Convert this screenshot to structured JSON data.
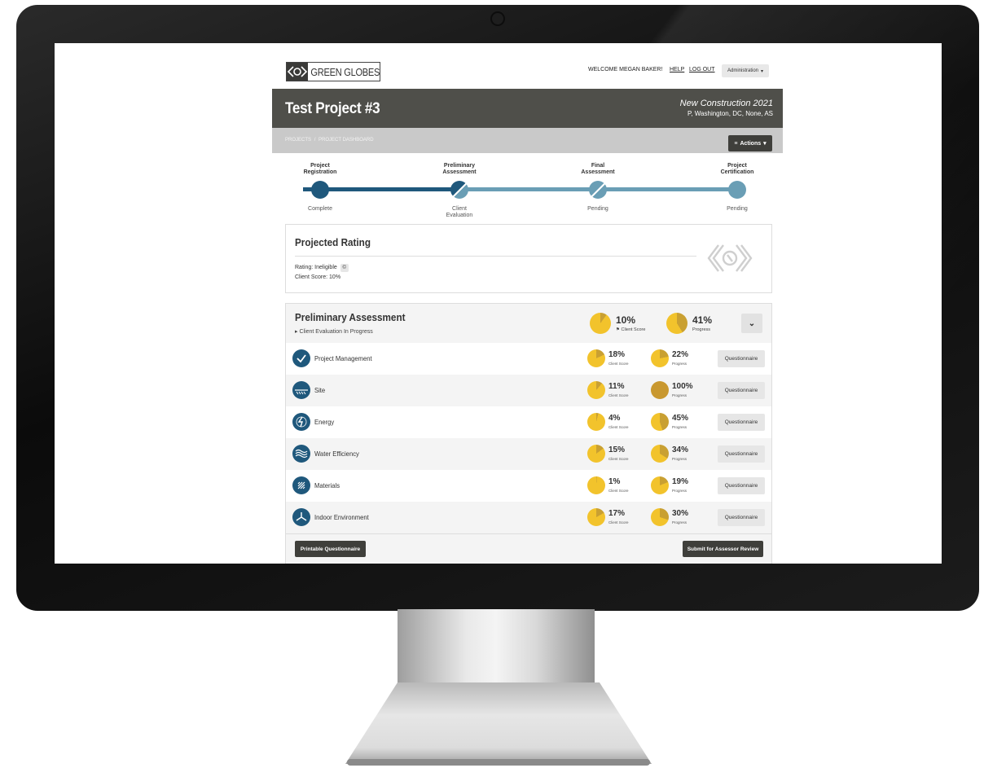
{
  "brand": {
    "name": "GREEN GLOBES"
  },
  "topnav": {
    "welcome": "WELCOME MEGAN BAKER!",
    "help": "HELP",
    "logout": "LOG OUT",
    "admin": "Administration"
  },
  "project": {
    "title": "Test Project #3",
    "type": "New Construction 2021",
    "location": "P, Washington, DC, None, AS"
  },
  "breadcrumb": {
    "projects": "PROJECTS",
    "separator": "/",
    "current": "PROJECT DASHBOARD"
  },
  "actions_label": "Actions",
  "steps": [
    {
      "title_1": "Project",
      "title_2": "Registration",
      "status_1": "Complete",
      "status_2": ""
    },
    {
      "title_1": "Preliminary",
      "title_2": "Assessment",
      "status_1": "Client",
      "status_2": "Evaluation"
    },
    {
      "title_1": "Final",
      "title_2": "Assessment",
      "status_1": "Pending",
      "status_2": ""
    },
    {
      "title_1": "Project",
      "title_2": "Certification",
      "status_1": "Pending",
      "status_2": ""
    }
  ],
  "projected_rating": {
    "title": "Projected Rating",
    "rating_label": "Rating:",
    "rating_value": "Ineligible",
    "client_score_label": "Client Score:",
    "client_score_value": "10%"
  },
  "assessment": {
    "title": "Preliminary Assessment",
    "status": "Client Evaluation In Progress",
    "client_score": {
      "pct": "10%",
      "label": "Client Score",
      "value": 0.1
    },
    "progress": {
      "pct": "41%",
      "label": "Progress",
      "value": 0.41
    },
    "categories": [
      {
        "name": "Project Management",
        "icon": "check-icon",
        "score": "18%",
        "score_value": 0.18,
        "progress": "22%",
        "progress_value": 0.22
      },
      {
        "name": "Site",
        "icon": "site-icon",
        "score": "11%",
        "score_value": 0.11,
        "progress": "100%",
        "progress_value": 1.0
      },
      {
        "name": "Energy",
        "icon": "energy-icon",
        "score": "4%",
        "score_value": 0.04,
        "progress": "45%",
        "progress_value": 0.45
      },
      {
        "name": "Water Efficiency",
        "icon": "water-icon",
        "score": "15%",
        "score_value": 0.15,
        "progress": "34%",
        "progress_value": 0.34
      },
      {
        "name": "Materials",
        "icon": "materials-icon",
        "score": "1%",
        "score_value": 0.01,
        "progress": "19%",
        "progress_value": 0.19
      },
      {
        "name": "Indoor Environment",
        "icon": "indoor-environment-icon",
        "score": "17%",
        "score_value": 0.17,
        "progress": "30%",
        "progress_value": 0.3
      }
    ],
    "small_score_label": "Client Score",
    "small_progress_label": "Progress",
    "questionnaire_label": "Questionnaire",
    "printable_label": "Printable Questionnaire",
    "submit_label": "Submit for Assessor Review"
  },
  "colors": {
    "dark_header": "#4f4f4a",
    "step_dark": "#1f587c",
    "step_light": "#6a9eb5",
    "pie_fill": "#f2c32c",
    "pie_slice": "#c9a032",
    "pie_complete": "#c9982f"
  }
}
